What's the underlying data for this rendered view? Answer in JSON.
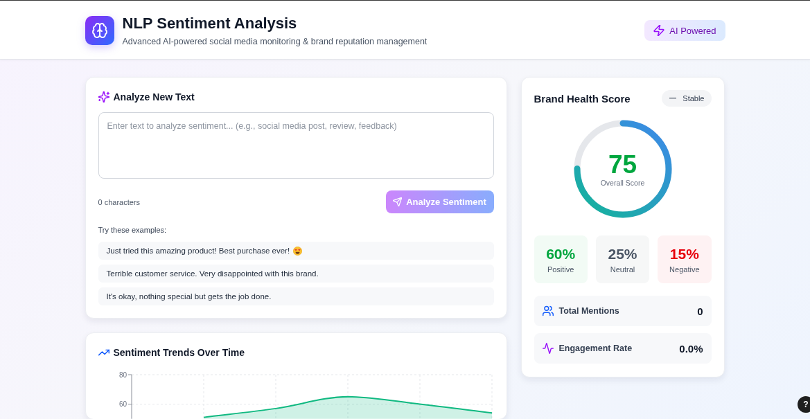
{
  "header": {
    "title": "NLP Sentiment Analysis",
    "subtitle": "Advanced AI-powered social media monitoring & brand reputation management",
    "badge": "AI Powered"
  },
  "analyze": {
    "title": "Analyze New Text",
    "input": {
      "placeholder": "Enter text to analyze sentiment... (e.g., social media post, review, feedback)"
    },
    "char_count": "0 characters",
    "button": {
      "label": "Analyze Sentiment",
      "disabled": true
    },
    "examples_label": "Try these examples:",
    "examples": [
      {
        "text": "Just tried this amazing product! Best purchase ever!",
        "emoji": true
      },
      {
        "text": "Terrible customer service. Very disappointed with this brand.",
        "emoji": false
      },
      {
        "text": "It's okay, nothing special but gets the job done.",
        "emoji": false
      }
    ]
  },
  "trends": {
    "title": "Sentiment Trends Over Time",
    "chart_data": {
      "type": "area",
      "categories": [
        null,
        null,
        null,
        null,
        null,
        null
      ],
      "values": [
        null,
        51,
        57,
        65,
        60,
        54
      ],
      "ylim": [
        50,
        80
      ],
      "yticks": [
        60,
        80
      ],
      "grid": true
    }
  },
  "brand_health": {
    "title": "Brand Health Score",
    "trend": "Stable",
    "score": {
      "value": "75",
      "label": "Overall Score",
      "level": 0.75
    },
    "breakdown": [
      {
        "value": "60%",
        "label": "Positive",
        "color": "#00a63e"
      },
      {
        "value": "25%",
        "label": "Neutral",
        "color": "#4a5565"
      },
      {
        "value": "15%",
        "label": "Negative",
        "color": "#e7000b"
      }
    ],
    "metrics": [
      {
        "kind": "mentions",
        "label": "Total Mentions",
        "value": "0"
      },
      {
        "kind": "engagement",
        "label": "Engagement Rate",
        "value": "0.0%"
      }
    ]
  },
  "help_button": {
    "label": "?"
  }
}
